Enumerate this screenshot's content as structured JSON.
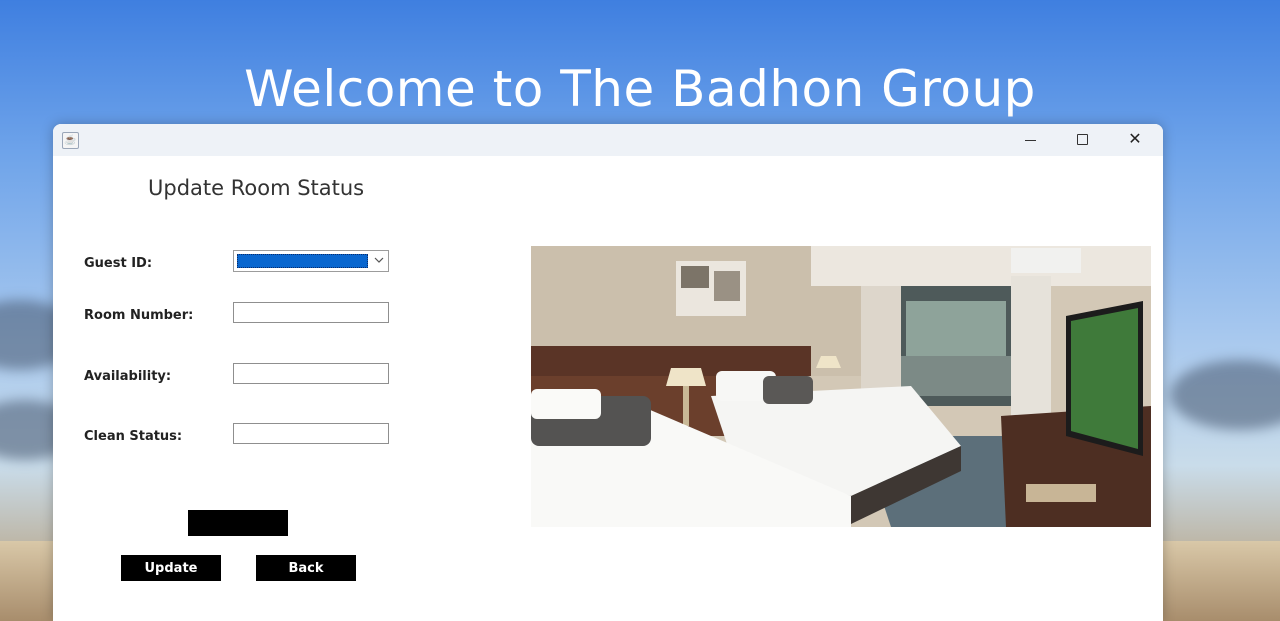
{
  "background": {
    "welcome_text": "Welcome to The Badhon Group"
  },
  "window": {
    "titlebar_icon": "java-icon",
    "controls": [
      "minimize-icon",
      "maximize-icon",
      "close-icon"
    ],
    "close_glyph": "✕"
  },
  "form": {
    "title": "Update Room Status",
    "fields": {
      "guest_id": {
        "label": "Guest ID:",
        "value": ""
      },
      "room_number": {
        "label": "Room Number:",
        "value": ""
      },
      "availability": {
        "label": "Availability:",
        "value": ""
      },
      "clean_status": {
        "label": "Clean Status:",
        "value": ""
      }
    },
    "buttons": {
      "update": "Update",
      "back": "Back"
    }
  },
  "colors": {
    "button_bg": "#000000",
    "button_text": "#ffffff",
    "select_highlight": "#0a67cf"
  }
}
